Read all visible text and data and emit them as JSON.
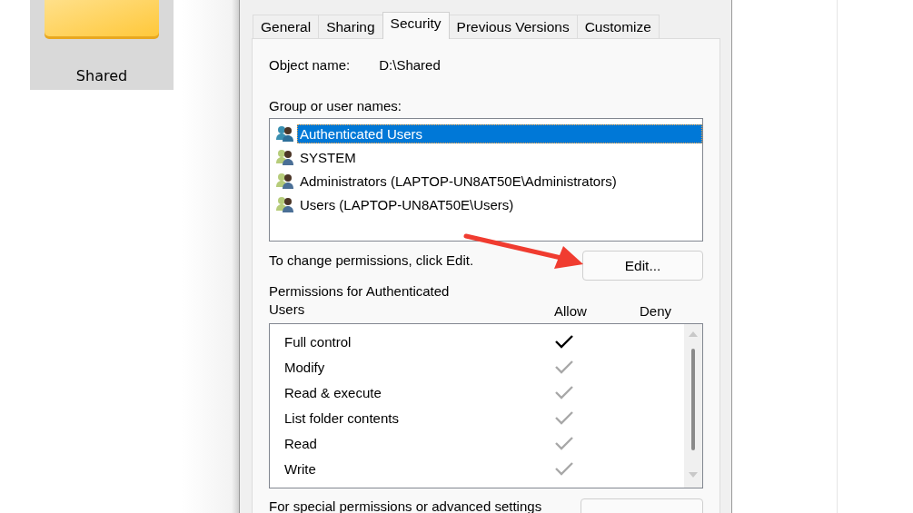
{
  "desktop_item": {
    "label": "Shared"
  },
  "dialog": {
    "tabs": [
      {
        "label": "General",
        "selected": false
      },
      {
        "label": "Sharing",
        "selected": false
      },
      {
        "label": "Security",
        "selected": true
      },
      {
        "label": "Previous Versions",
        "selected": false
      },
      {
        "label": "Customize",
        "selected": false
      }
    ],
    "object_name_label": "Object name:",
    "object_name": "D:\\Shared",
    "group_label": "Group or user names:",
    "groups": [
      {
        "name": "Authenticated Users",
        "selected": true
      },
      {
        "name": "SYSTEM",
        "selected": false
      },
      {
        "name": "Administrators (LAPTOP-UN8AT50E\\Administrators)",
        "selected": false
      },
      {
        "name": "Users (LAPTOP-UN8AT50E\\Users)",
        "selected": false
      }
    ],
    "change_hint": "To change permissions, click Edit.",
    "edit_button": "Edit...",
    "permissions_label": "Permissions for Authenticated Users",
    "allow_header": "Allow",
    "deny_header": "Deny",
    "permissions": [
      {
        "name": "Full control",
        "allow": true,
        "allow_inherited": false,
        "deny": false
      },
      {
        "name": "Modify",
        "allow": true,
        "allow_inherited": true,
        "deny": false
      },
      {
        "name": "Read & execute",
        "allow": true,
        "allow_inherited": true,
        "deny": false
      },
      {
        "name": "List folder contents",
        "allow": true,
        "allow_inherited": true,
        "deny": false
      },
      {
        "name": "Read",
        "allow": true,
        "allow_inherited": true,
        "deny": false
      },
      {
        "name": "Write",
        "allow": true,
        "allow_inherited": true,
        "deny": false
      }
    ],
    "advanced_hint": "For special permissions or advanced settings"
  }
}
